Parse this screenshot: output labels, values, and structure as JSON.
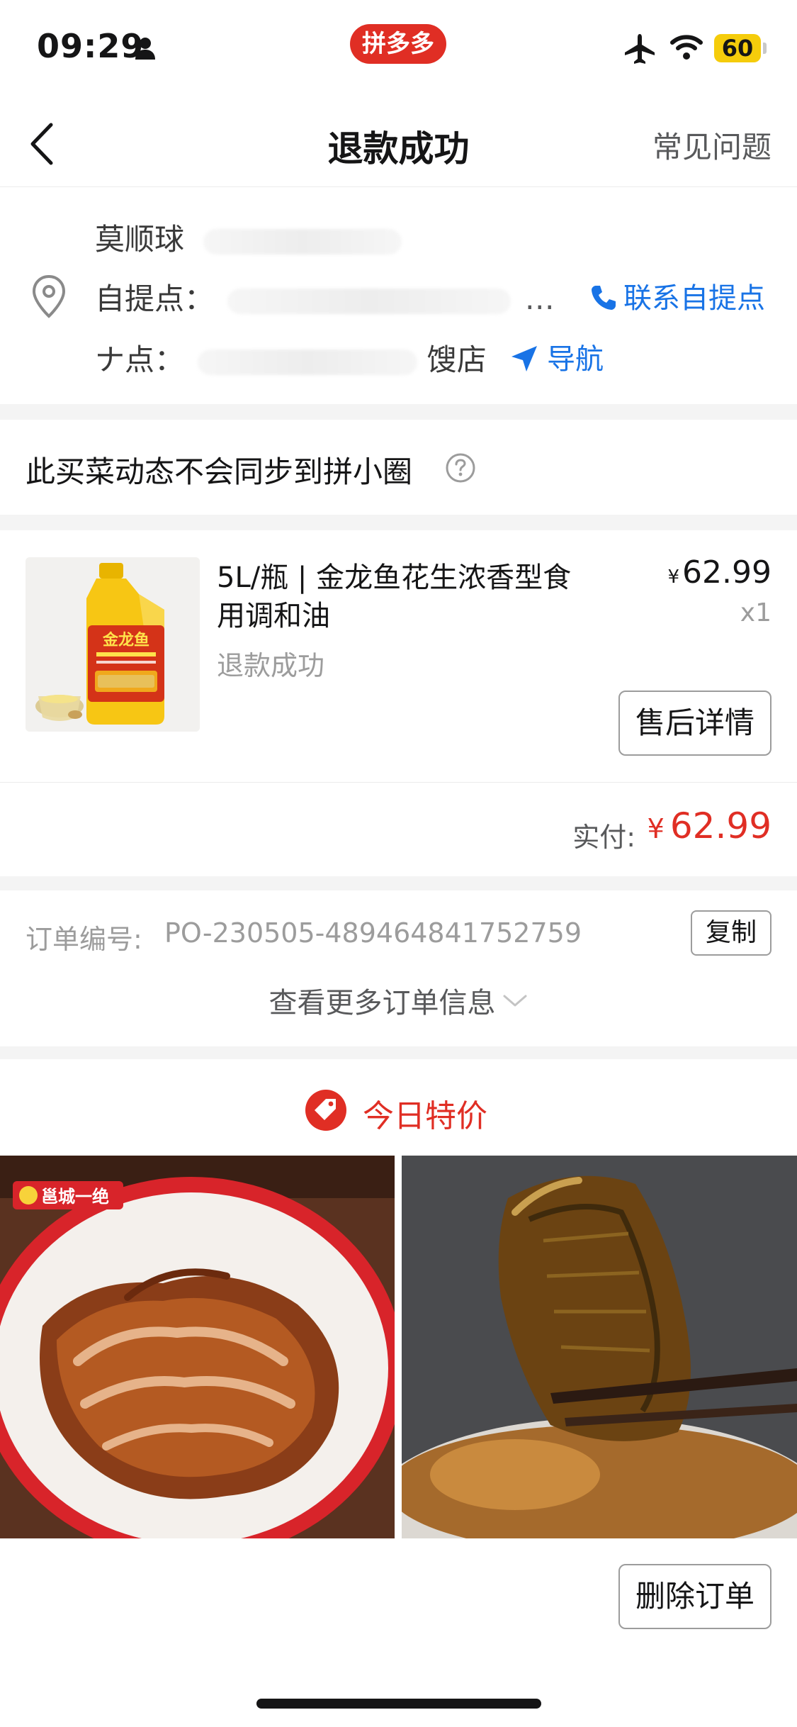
{
  "status_bar": {
    "time": "09:29",
    "app_badge": "拼多多",
    "battery": "60",
    "icons": [
      "person-icon",
      "airplane-icon",
      "wifi-icon",
      "battery-icon"
    ]
  },
  "nav": {
    "title": "退款成功",
    "faq": "常见问题",
    "back_icon": "chevron-left-icon"
  },
  "address": {
    "name": "莫顺球",
    "pickup_label": "自提点：",
    "pickup_ellipsis": "…",
    "contact_label": "联系自提点",
    "store_prefix": "ナ点：",
    "store_suffix": "馊店",
    "navigate_label": "导航",
    "accent_color": "#1873e6"
  },
  "sync_notice": {
    "text": "此买菜动态不会同步到拼小圈",
    "help_icon": "question-circle-icon"
  },
  "product": {
    "name": "5L/瓶 | 金龙鱼花生浓香型食用调和油",
    "status": "退款成功",
    "price_symbol": "¥",
    "price": "62.99",
    "quantity": "x1",
    "after_sale_button": "售后详情",
    "image_brand": "金龙鱼"
  },
  "payment": {
    "label": "实付:",
    "symbol": "¥",
    "amount": "62.99",
    "color": "#e02e24"
  },
  "order": {
    "number_label": "订单编号:",
    "number": "PO-230505-489464841752759",
    "copy_button": "复制",
    "more_info": "查看更多订单信息"
  },
  "deals": {
    "title": "今日特价",
    "icon": "price-tag-icon",
    "items": [
      {
        "image": "roast-duck-photo",
        "brand": "邕城一绝"
      },
      {
        "image": "braised-fish-photo"
      }
    ]
  },
  "footer": {
    "delete_button": "删除订单"
  }
}
